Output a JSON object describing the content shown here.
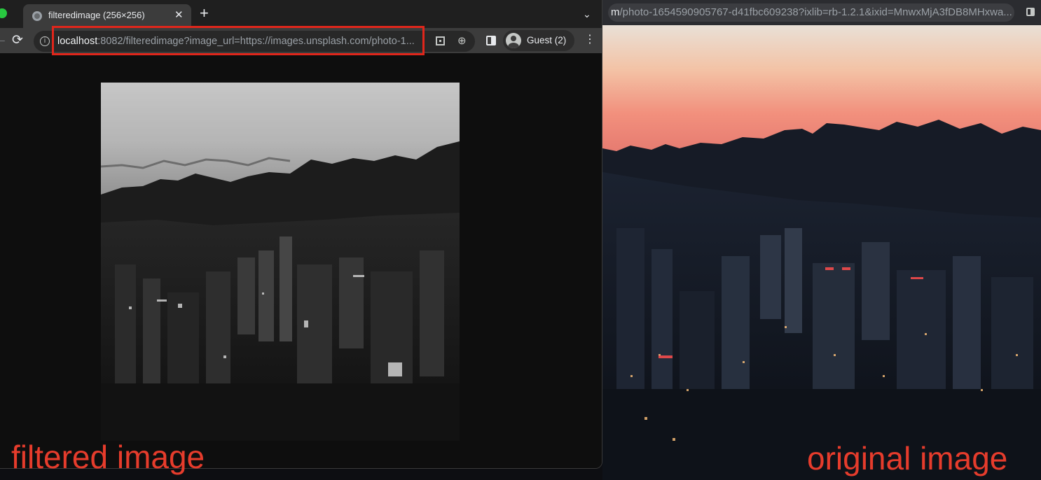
{
  "background_browser": {
    "url_prefix": "m",
    "url_rest": "/photo-1654590905767-d41fbc609238?ixlib=rb-1.2.1&ixid=MnwxMjA3fDB8MHxwa..."
  },
  "foreground_browser": {
    "tab": {
      "title": "filteredimage (256×256)",
      "close": "✕"
    },
    "new_tab": "+",
    "tab_search": "⌄",
    "url": {
      "host": "localhost",
      "rest": ":8082/filteredimage?image_url=https://images.unsplash.com/photo-1..."
    },
    "profile": {
      "label": "Guest (2)"
    },
    "menu": "⋮",
    "reload": "C",
    "info": "i",
    "zoom": "⊕"
  },
  "captions": {
    "filtered": "filtered image",
    "original": "original image"
  },
  "colors": {
    "highlight": "#e0261b",
    "caption": "#e63c2c",
    "traffic_green": "#28c840"
  }
}
